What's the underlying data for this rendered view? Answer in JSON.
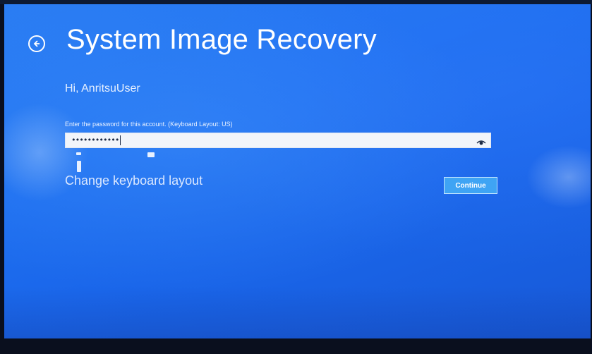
{
  "app": {
    "title": "System Image Recovery",
    "greeting": "Hi, AnritsuUser",
    "prompt": "Enter the password for this account. (Keyboard Layout: US)"
  },
  "password": {
    "value": "••••••••••••",
    "reveal_icon": "eye-icon"
  },
  "links": {
    "change_keyboard": "Change keyboard layout"
  },
  "buttons": {
    "continue": "Continue",
    "back_icon": "back-arrow-icon"
  },
  "colors": {
    "background": "#1e6ff0",
    "accent": "#3fa4f4",
    "text": "#ffffff"
  }
}
